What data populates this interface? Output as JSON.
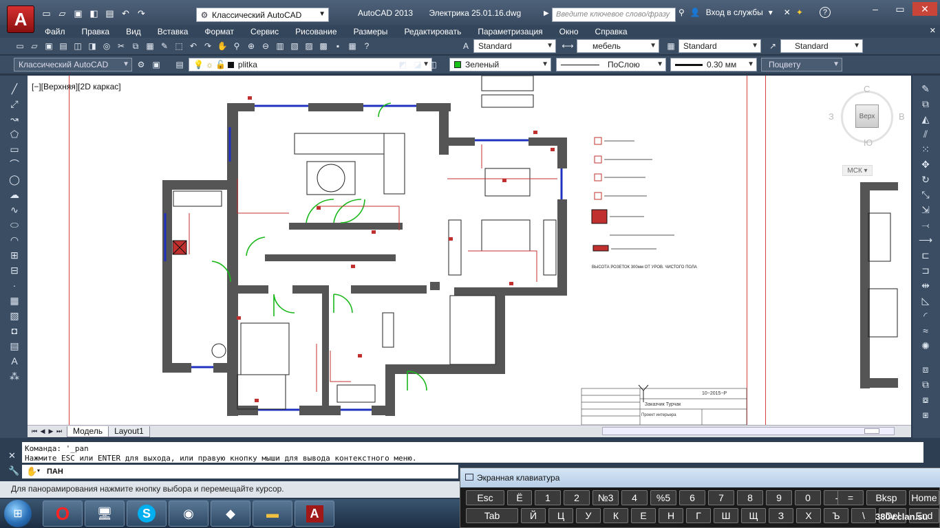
{
  "app": {
    "app_button_label": "A",
    "workspace": "Классический AutoCAD",
    "product": "AutoCAD 2013",
    "file": "Электрика 25.01.16.dwg",
    "search_placeholder": "Введите ключевое слово/фразу",
    "signin": "Вход в службы"
  },
  "menu": [
    "Файл",
    "Правка",
    "Вид",
    "Вставка",
    "Формат",
    "Сервис",
    "Рисование",
    "Размеры",
    "Редактировать",
    "Параметризация",
    "Окно",
    "Справка"
  ],
  "toolbar1": {
    "text_style": "Standard",
    "dim_style": "мебель",
    "table_style": "Standard",
    "mleader_style": "Standard"
  },
  "toolbar2": {
    "workspace": "Классический AutoCAD",
    "layer": "plitka",
    "color": "Зеленый",
    "linetype": "ПоСлою",
    "lineweight": "0.30 мм",
    "plotstyle": "Поцвету"
  },
  "viewport": {
    "label": "[−][Верхняя][2D каркас]",
    "cube": {
      "top": "Верх",
      "n": "С",
      "s": "Ю",
      "w": "З",
      "e": "В",
      "ucs": "МСК"
    }
  },
  "drawing": {
    "title_name": "Заказчик Турчак",
    "title_project": "Проект интерьера",
    "title_code": "10−2015−Р",
    "legend_note": "ВЫСОТА РОЗЕТОК 300мм ОТ УРОВ. ЧИСТОГО ПОЛА"
  },
  "layout_tabs": [
    "Модель",
    "Layout1"
  ],
  "command": {
    "line1": "Команда: '_pan",
    "line2": "Нажмите ESC или ENTER для выхода, или правую кнопку мыши для вывода контекстного меню.",
    "input": "ПАН"
  },
  "status": "Для панорамирования нажмите кнопку выбора и перемещайте курсор.",
  "osk": {
    "title": "Экранная клавиатура",
    "row1": [
      "Esc",
      "Ё",
      "1",
      "2",
      "№3",
      "4",
      "%5",
      "6",
      "7",
      "8",
      "9",
      "0",
      "-",
      "=",
      "Bksp",
      "Home"
    ],
    "row2": [
      "Tab",
      "Й",
      "Ц",
      "У",
      "К",
      "Е",
      "Н",
      "Г",
      "Ш",
      "Щ",
      "З",
      "Х",
      "Ъ",
      "\\",
      "Del",
      "End"
    ]
  },
  "watermark": "380v.clan.su",
  "colors": {
    "accent_red": "#c0302e",
    "wall": "#555555",
    "door": "#18b818",
    "window": "#2030c0"
  }
}
